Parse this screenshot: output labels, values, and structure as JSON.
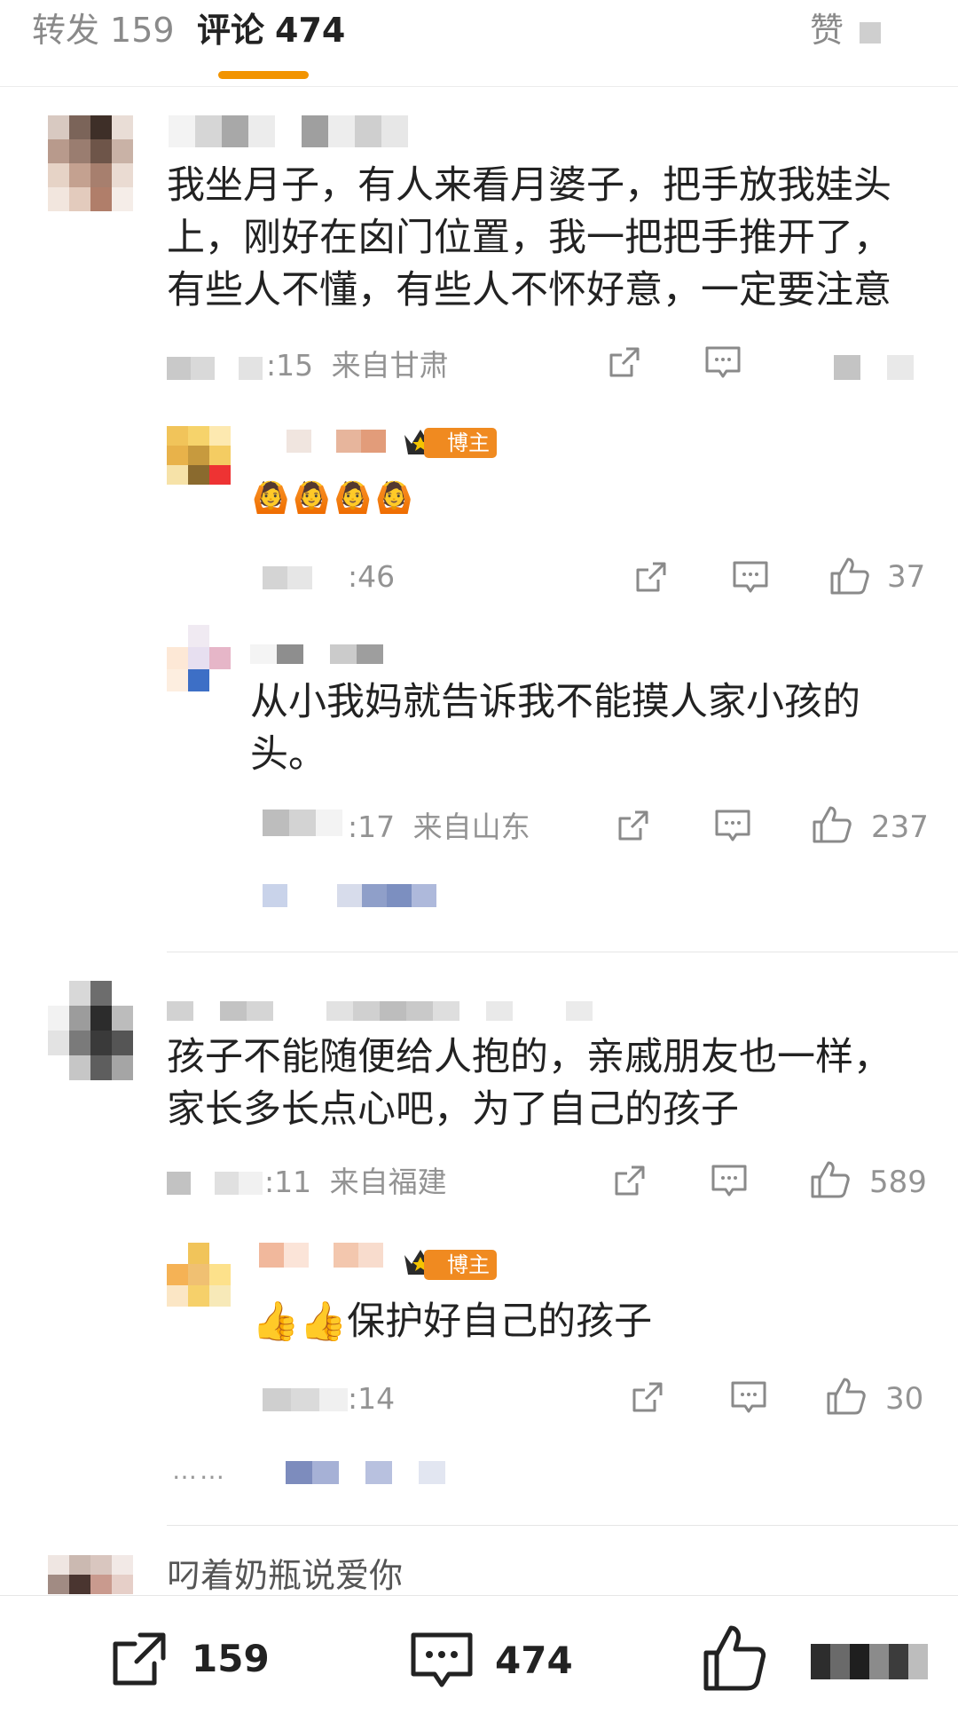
{
  "tabs": {
    "repost_label": "转发",
    "repost_count": "159",
    "comment_label": "评论",
    "comment_count": "474",
    "like_label": "赞"
  },
  "comments": [
    {
      "text_lines": [
        "我坐月子，有人来看月婆子，把手放我娃头",
        "上，刚好在囟门位置，我一把把手推开了，",
        "有些人不懂，有些人不怀好意，一定要注意"
      ],
      "time": ":15",
      "location": "来自甘肃",
      "replies": [
        {
          "badge": "博主",
          "emoji": "🙆🙆🙆🙆",
          "time": ":46",
          "likes": "37"
        },
        {
          "text_lines": [
            "从小我妈就告诉我不能摸人家小孩的",
            "头。"
          ],
          "time": ":17",
          "location": "来自山东",
          "likes": "237"
        }
      ]
    },
    {
      "text_lines": [
        "孩子不能随便给人抱的，亲戚朋友也一样，",
        "家长多长点心吧，为了自己的孩子"
      ],
      "time": ":11",
      "location": "来自福建",
      "likes": "589",
      "replies": [
        {
          "badge": "博主",
          "text": "👍👍保护好自己的孩子",
          "time": ":14",
          "likes": "30"
        }
      ],
      "more": "……"
    },
    {
      "text": "叼着奶瓶说爱你"
    }
  ],
  "bottom": {
    "repost_count": "159",
    "comment_count": "474"
  },
  "icons": {
    "share": "share-icon",
    "comment": "comment-icon",
    "like": "thumbs-up-icon"
  },
  "colors": {
    "accent": "#f29400",
    "badge": "#f08a20",
    "meta": "#939393"
  }
}
